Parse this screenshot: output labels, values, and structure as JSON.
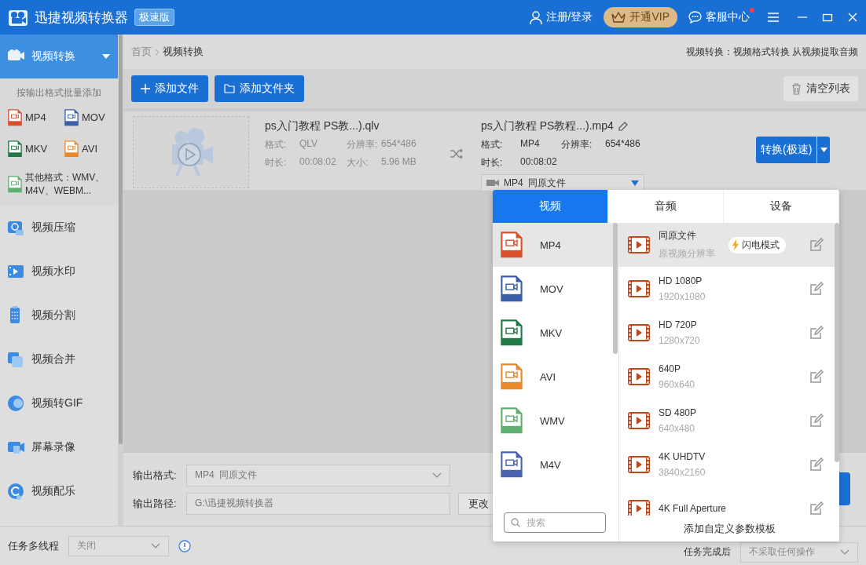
{
  "app": {
    "title": "迅捷视频转换器",
    "edition": "极速版"
  },
  "header": {
    "login": "注册/登录",
    "vip": "开通VIP",
    "service": "客服中心",
    "service_dot": true
  },
  "sidebar": {
    "items": [
      {
        "label": "视频转换",
        "selected": true,
        "expanded": true
      },
      {
        "label": "视频压缩",
        "selected": false
      },
      {
        "label": "视频水印",
        "selected": false
      },
      {
        "label": "视频分割",
        "selected": false
      },
      {
        "label": "视频合并",
        "selected": false
      },
      {
        "label": "视频转GIF",
        "selected": false
      },
      {
        "label": "屏幕录像",
        "selected": false
      },
      {
        "label": "视频配乐",
        "selected": false
      }
    ],
    "batch_hint": "按输出格式批量添加",
    "quick_formats": [
      {
        "label": "MP4",
        "color": "#d9512c"
      },
      {
        "label": "MOV",
        "color": "#3a5ea8"
      },
      {
        "label": "MKV",
        "color": "#1f7a45"
      },
      {
        "label": "AVI",
        "color": "#e8892c"
      }
    ],
    "other_formats": {
      "label": "其他格式：WMV、M4V、WEBM...",
      "color": "#5fb06f"
    }
  },
  "breadcrumb": [
    "首页",
    "视频转换"
  ],
  "page_hint": "视频转换：视频格式转换 从视频提取音频",
  "toolbar": {
    "add_file": "添加文件",
    "add_folder": "添加文件夹",
    "clear": "清空列表"
  },
  "file": {
    "source": {
      "name": "ps入门教程 PS教...).qlv",
      "fields": [
        {
          "label": "格式:",
          "value": "QLV"
        },
        {
          "label": "分辨率:",
          "value": "654*486"
        },
        {
          "label": "时长:",
          "value": "00:08:02"
        },
        {
          "label": "大小:",
          "value": "5.96 MB"
        }
      ]
    },
    "target": {
      "name": "ps入门教程 PS教程...).mp4",
      "fields": [
        {
          "label": "格式:",
          "value": "MP4"
        },
        {
          "label": "分辨率:",
          "value": "654*486"
        },
        {
          "label": "时长:",
          "value": "00:08:02"
        }
      ],
      "format_select": "MP4  同原文件"
    },
    "convert": "转换(极速)"
  },
  "output": {
    "format_label": "输出格式:",
    "format_value": "MP4  同原文件",
    "path_label": "输出路径:",
    "path_value": "G:\\迅捷视频转换器",
    "change": "更改"
  },
  "bottom": {
    "threads_label": "任务多线程",
    "threads_value": "关闭",
    "after_label": "任务完成后",
    "after_value": "不采取任何操作"
  },
  "popup": {
    "tabs": [
      {
        "label": "视频",
        "selected": true
      },
      {
        "label": "音频",
        "selected": false
      },
      {
        "label": "设备",
        "selected": false
      }
    ],
    "formats": [
      {
        "label": "MP4",
        "color": "#d9512c",
        "selected": true
      },
      {
        "label": "MOV",
        "color": "#3a5ea8",
        "selected": false
      },
      {
        "label": "MKV",
        "color": "#1f7a45",
        "selected": false
      },
      {
        "label": "AVI",
        "color": "#e8892c",
        "selected": false
      },
      {
        "label": "WMV",
        "color": "#5fb06f",
        "selected": false
      },
      {
        "label": "M4V",
        "color": "#4a62b0",
        "selected": false
      }
    ],
    "presets": [
      {
        "name": "同原文件",
        "resolution": "原视频分辨率",
        "badge": "闪电模式",
        "selected": true
      },
      {
        "name": "HD 1080P",
        "resolution": "1920x1080",
        "selected": false
      },
      {
        "name": "HD 720P",
        "resolution": "1280x720",
        "selected": false
      },
      {
        "name": "640P",
        "resolution": "960x640",
        "selected": false
      },
      {
        "name": "SD 480P",
        "resolution": "640x480",
        "selected": false
      },
      {
        "name": "4K UHDTV",
        "resolution": "3840x2160",
        "selected": false
      },
      {
        "name": "4K Full Aperture",
        "selected": false
      }
    ],
    "search_placeholder": "搜索",
    "add_custom": "添加自定义参数模板"
  }
}
